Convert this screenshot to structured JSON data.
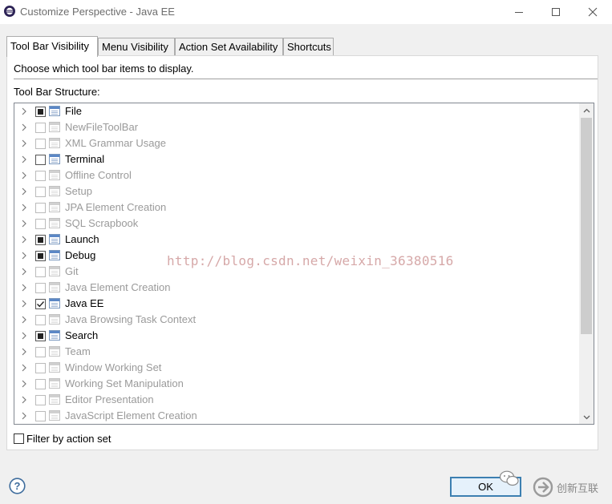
{
  "window": {
    "title": "Customize Perspective - Java EE",
    "controls": [
      "minimize",
      "maximize",
      "close"
    ]
  },
  "tabs": [
    {
      "label": "Tool Bar Visibility",
      "active": true
    },
    {
      "label": "Menu Visibility",
      "active": false
    },
    {
      "label": "Action Set Availability",
      "active": false
    },
    {
      "label": "Shortcuts",
      "active": false
    }
  ],
  "panel": {
    "description": "Choose which tool bar items to display.",
    "structure_label": "Tool Bar Structure:"
  },
  "tree": {
    "items": [
      {
        "label": "File",
        "state": "partial",
        "enabled": true
      },
      {
        "label": "NewFileToolBar",
        "state": "unchecked",
        "enabled": false
      },
      {
        "label": "XML Grammar Usage",
        "state": "unchecked",
        "enabled": false
      },
      {
        "label": "Terminal",
        "state": "unchecked",
        "enabled": true
      },
      {
        "label": "Offline Control",
        "state": "unchecked",
        "enabled": false
      },
      {
        "label": "Setup",
        "state": "unchecked",
        "enabled": false
      },
      {
        "label": "JPA Element Creation",
        "state": "unchecked",
        "enabled": false
      },
      {
        "label": "SQL Scrapbook",
        "state": "unchecked",
        "enabled": false
      },
      {
        "label": "Launch",
        "state": "partial",
        "enabled": true
      },
      {
        "label": "Debug",
        "state": "partial",
        "enabled": true
      },
      {
        "label": "Git",
        "state": "unchecked",
        "enabled": false
      },
      {
        "label": "Java Element Creation",
        "state": "unchecked",
        "enabled": false
      },
      {
        "label": "Java EE",
        "state": "checked",
        "enabled": true
      },
      {
        "label": "Java Browsing Task Context",
        "state": "unchecked",
        "enabled": false
      },
      {
        "label": "Search",
        "state": "partial",
        "enabled": true
      },
      {
        "label": "Team",
        "state": "unchecked",
        "enabled": false
      },
      {
        "label": "Window Working Set",
        "state": "unchecked",
        "enabled": false
      },
      {
        "label": "Working Set Manipulation",
        "state": "unchecked",
        "enabled": false
      },
      {
        "label": "Editor Presentation",
        "state": "unchecked",
        "enabled": false
      },
      {
        "label": "JavaScript Element Creation",
        "state": "unchecked",
        "enabled": false
      }
    ]
  },
  "watermark": "http://blog.csdn.net/weixin_36380516",
  "filter": {
    "label": "Filter by action set",
    "checked": false
  },
  "footer": {
    "ok_label": "OK",
    "brand_name": "创新互联"
  },
  "colors": {
    "accent": "#3c7fb1",
    "disabled_text": "#9a9a9a"
  }
}
